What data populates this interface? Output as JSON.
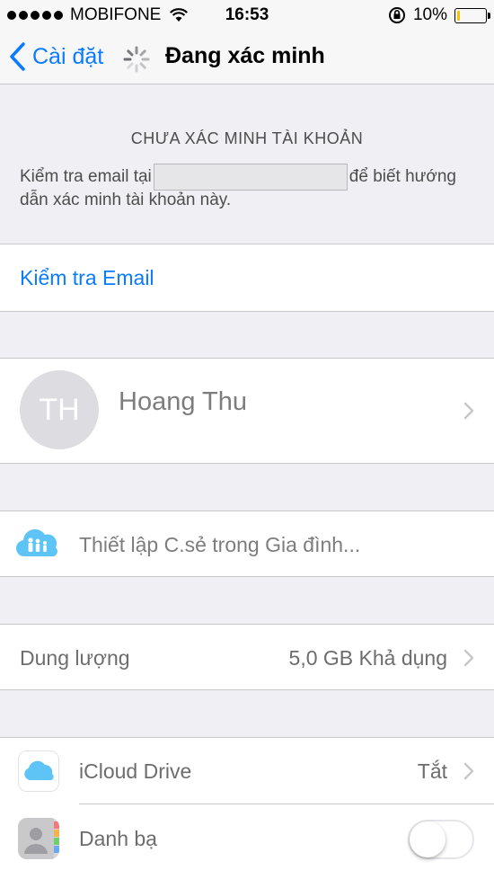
{
  "status_bar": {
    "carrier": "MOBIFONE",
    "time": "16:53",
    "battery": "10%",
    "battery_level": 0.1,
    "battery_color": "#f5c400",
    "icons": [
      "signal-dots-icon",
      "wifi-icon",
      "rotation-lock-icon",
      "battery-icon"
    ]
  },
  "nav": {
    "back_label": "Cài đặt",
    "title": "Đang xác minh",
    "icons": [
      "chevron-left-icon",
      "spinner-icon"
    ]
  },
  "verify": {
    "heading": "CHƯA XÁC MINH TÀI KHOẢN",
    "text_before": "Kiểm tra email tại",
    "text_after": "để biết hướng",
    "text_line2": "dẫn xác minh tài khoản này."
  },
  "check_email": {
    "label": "Kiểm tra Email"
  },
  "profile": {
    "initials": "TH",
    "name": "Hoang Thu"
  },
  "family": {
    "label": "Thiết lập C.sẻ trong Gia đình..."
  },
  "storage": {
    "label": "Dung lượng",
    "value": "5,0 GB Khả dụng"
  },
  "apps": [
    {
      "label": "iCloud Drive",
      "value": "Tắt",
      "icon": "icloud-drive-icon"
    },
    {
      "label": "Danh bạ",
      "toggle": false,
      "icon": "contacts-icon"
    }
  ],
  "colors": {
    "accent": "#0b7bfe",
    "background": "#efeff4"
  }
}
